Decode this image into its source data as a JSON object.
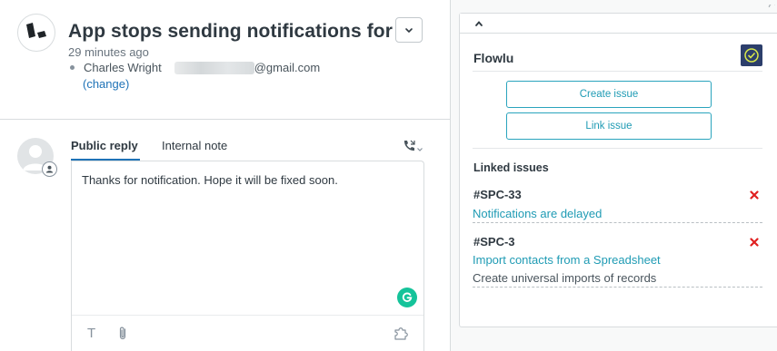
{
  "ticket": {
    "title": "App stops sending notifications for ...",
    "time_ago": "29 minutes ago",
    "requester_name": "Charles Wright",
    "requester_email_domain": "@gmail.com",
    "change_label": "(change)"
  },
  "composer": {
    "tabs": [
      {
        "label": "Public reply",
        "active": true
      },
      {
        "label": "Internal note",
        "active": false
      }
    ],
    "reply_text": "Thanks for notification. Hope it will be fixed soon.",
    "toolbar": {
      "text_format_glyph": "T"
    }
  },
  "sidebar_app": {
    "name": "Flowlu",
    "buttons": {
      "create": "Create issue",
      "link": "Link issue"
    },
    "linked_heading": "Linked issues",
    "issues": [
      {
        "id": "#SPC-33",
        "title": "Notifications are delayed",
        "description": ""
      },
      {
        "id": "#SPC-3",
        "title": "Import contacts from a Spreadsheet",
        "description": "Create universal imports of records"
      }
    ]
  },
  "colors": {
    "accent": "#1f73b7",
    "app_accent": "#1f9bb4",
    "delete": "#e02020",
    "grammarly": "#15c39a",
    "app_logo_bg": "#2c3e6b"
  },
  "icons": {
    "brand": "zendesk-logo-icon",
    "chevron": "chevron-down-icon",
    "call": "phone-call-icon",
    "attach": "paperclip-icon",
    "apps": "puzzle-piece-icon",
    "collapse": "chevron-up-icon",
    "delete": "close-x-icon"
  }
}
